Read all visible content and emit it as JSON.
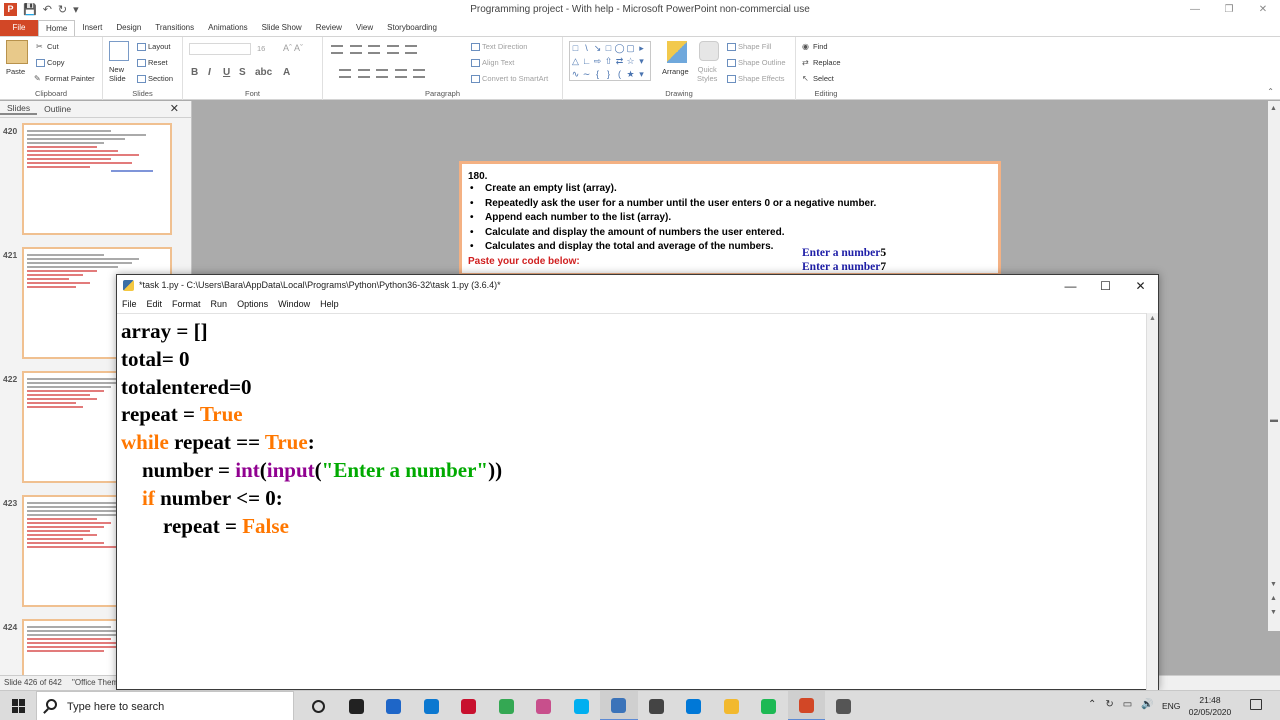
{
  "window": {
    "title": "Programming project - With help - Microsoft PowerPoint non-commercial use"
  },
  "ribbon": {
    "tabs": [
      {
        "label": "File"
      },
      {
        "label": "Home"
      },
      {
        "label": "Insert"
      },
      {
        "label": "Design"
      },
      {
        "label": "Transitions"
      },
      {
        "label": "Animations"
      },
      {
        "label": "Slide Show"
      },
      {
        "label": "Review"
      },
      {
        "label": "View"
      },
      {
        "label": "Storyboarding"
      }
    ],
    "clipboard": {
      "paste": "Paste",
      "cut": "Cut",
      "copy": "Copy",
      "format_painter": "Format Painter",
      "label": "Clipboard"
    },
    "slides": {
      "new_slide_1": "New",
      "new_slide_2": "Slide",
      "layout": "Layout",
      "reset": "Reset",
      "section": "Section",
      "label": "Slides"
    },
    "font": {
      "size": "16",
      "label": "Font"
    },
    "paragraph": {
      "text_direction": "Text Direction",
      "align_text": "Align Text",
      "convert_smartart": "Convert to SmartArt",
      "label": "Paragraph"
    },
    "drawing": {
      "arrange": "Arrange",
      "quick_styles_1": "Quick",
      "quick_styles_2": "Styles",
      "shape_fill": "Shape Fill",
      "shape_outline": "Shape Outline",
      "shape_effects": "Shape Effects",
      "label": "Drawing"
    },
    "editing": {
      "find": "Find",
      "replace": "Replace",
      "select": "Select",
      "label": "Editing"
    }
  },
  "panel": {
    "tab_slides": "Slides",
    "tab_outline": "Outline",
    "thumbs": [
      {
        "num": "420"
      },
      {
        "num": "421"
      },
      {
        "num": "422"
      },
      {
        "num": "423"
      },
      {
        "num": "424"
      }
    ]
  },
  "slide": {
    "number": "180.",
    "bullets": [
      "Create an empty list (array).",
      "Repeatedly ask the user for a number until the user enters 0 or a negative number.",
      "Append each number to the list (array).",
      "Calculate and display the amount of numbers the user entered.",
      "Calculates and display the total and average of the numbers."
    ],
    "paste_label": "Paste your code below:",
    "console": [
      {
        "prompt": "Enter a number",
        "value": "5"
      },
      {
        "prompt": "Enter a number",
        "value": "7"
      }
    ]
  },
  "status": {
    "slide_info": "Slide 426 of 642",
    "theme": "\"Office Them"
  },
  "idle": {
    "title": "*task 1.py - C:\\Users\\Bara\\AppData\\Local\\Programs\\Python\\Python36-32\\task 1.py (3.6.4)*",
    "menu": [
      "File",
      "Edit",
      "Format",
      "Run",
      "Options",
      "Window",
      "Help"
    ],
    "code_tokens": {
      "l1": "array = []",
      "l2": "total= 0",
      "l3": "totalentered=0",
      "l4a": "repeat = ",
      "l4b": "True",
      "l5a": "while",
      "l5b": " repeat == ",
      "l5c": "True",
      "l5d": ":",
      "l6a": "    number = ",
      "l6b": "int",
      "l6c": "(",
      "l6d": "input",
      "l6e": "(",
      "l6f": "\"Enter a number\"",
      "l6g": "))",
      "l7a": "    ",
      "l7b": "if",
      "l7c": " number <= 0:",
      "l8a": "        repeat = ",
      "l8b": "False"
    }
  },
  "taskbar": {
    "search_placeholder": "Type here to search",
    "lang": "ENG",
    "time": "21:48",
    "date": "02/05/2020",
    "app_colors": [
      "#222222",
      "#1e66c8",
      "#0b78d0",
      "#c8102e",
      "#34a853",
      "#c84f8c",
      "#00aff0",
      "#3b73b9",
      "#444444",
      "#0078d7",
      "#f2b92e",
      "#1db954",
      "#d24726",
      "#555555"
    ]
  },
  "colors": {
    "accent_file": "#d24726",
    "slide_border": "#f4b183",
    "python_keyword": "#ff7700",
    "python_builtin": "#900090",
    "python_string": "#00aa00"
  }
}
